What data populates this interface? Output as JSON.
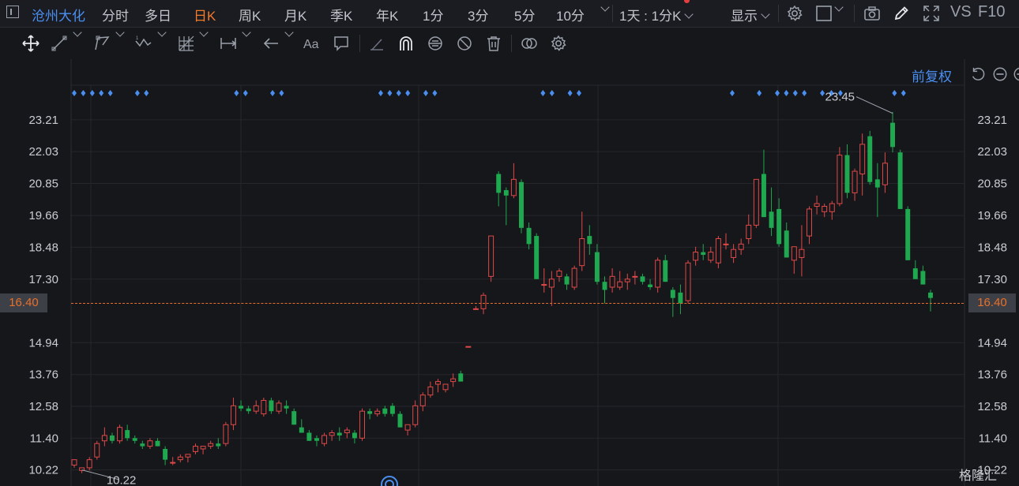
{
  "toolbar": {
    "stock_name": "沧州大化",
    "period_tabs": [
      {
        "label": "分时",
        "active": false
      },
      {
        "label": "多日",
        "active": false
      },
      {
        "label": "日K",
        "active": true
      },
      {
        "label": "周K",
        "active": false
      },
      {
        "label": "月K",
        "active": false
      },
      {
        "label": "季K",
        "active": false
      },
      {
        "label": "年K",
        "active": false
      },
      {
        "label": "1分",
        "active": false
      },
      {
        "label": "3分",
        "active": false
      },
      {
        "label": "5分",
        "active": false
      },
      {
        "label": "10分",
        "active": false
      }
    ],
    "interval_select": "1天 : 1分K",
    "display_label": "显示",
    "vs_label": "VS",
    "f10_label": "F10"
  },
  "adjust_mode": "前复权",
  "chart_data": {
    "type": "candlestick",
    "y_ticks": [
      23.21,
      22.03,
      20.85,
      19.66,
      18.48,
      17.3,
      14.94,
      13.76,
      12.58,
      11.4,
      10.22
    ],
    "ylim": [
      9.8,
      24.2
    ],
    "current_price": 16.4,
    "current_price_label": "16.40",
    "annotations": [
      {
        "label": "23.45",
        "value": 23.45,
        "type": "max"
      },
      {
        "label": "10.22",
        "value": 10.22,
        "type": "min"
      }
    ],
    "candles": [
      [
        10.4,
        10.6,
        10.3,
        10.6
      ],
      [
        10.2,
        10.3,
        10.1,
        10.3
      ],
      [
        10.3,
        10.7,
        10.2,
        10.6
      ],
      [
        10.7,
        11.3,
        10.6,
        11.2
      ],
      [
        11.3,
        11.8,
        11.1,
        11.5
      ],
      [
        11.5,
        11.6,
        11.2,
        11.3
      ],
      [
        11.3,
        11.9,
        11.2,
        11.8
      ],
      [
        11.7,
        11.9,
        11.3,
        11.4
      ],
      [
        11.4,
        11.5,
        11.2,
        11.3
      ],
      [
        11.2,
        11.3,
        11.0,
        11.1
      ],
      [
        11.1,
        11.4,
        11.0,
        11.3
      ],
      [
        11.3,
        11.4,
        11.1,
        11.1
      ],
      [
        11.0,
        11.1,
        10.4,
        10.6
      ],
      [
        10.5,
        10.7,
        10.4,
        10.5
      ],
      [
        10.6,
        10.8,
        10.5,
        10.7
      ],
      [
        10.7,
        10.8,
        10.5,
        10.8
      ],
      [
        10.9,
        11.2,
        10.8,
        11.1
      ],
      [
        11.0,
        11.1,
        10.8,
        11.1
      ],
      [
        11.1,
        11.3,
        11.0,
        11.2
      ],
      [
        11.2,
        11.4,
        11.0,
        11.1
      ],
      [
        11.2,
        12.0,
        11.1,
        11.9
      ],
      [
        11.9,
        12.9,
        11.7,
        12.6
      ],
      [
        12.6,
        12.8,
        12.4,
        12.5
      ],
      [
        12.5,
        12.6,
        12.3,
        12.4
      ],
      [
        12.4,
        12.8,
        12.3,
        12.6
      ],
      [
        12.3,
        12.9,
        12.2,
        12.8
      ],
      [
        12.8,
        12.9,
        12.3,
        12.4
      ],
      [
        12.4,
        12.8,
        12.3,
        12.7
      ],
      [
        12.6,
        12.8,
        12.3,
        12.5
      ],
      [
        12.4,
        12.5,
        11.9,
        11.9
      ],
      [
        11.8,
        12.1,
        11.6,
        11.6
      ],
      [
        11.6,
        11.7,
        11.3,
        11.3
      ],
      [
        11.4,
        11.5,
        11.1,
        11.3
      ],
      [
        11.2,
        11.6,
        11.1,
        11.5
      ],
      [
        11.5,
        11.7,
        11.3,
        11.6
      ],
      [
        11.6,
        11.8,
        11.3,
        11.5
      ],
      [
        11.6,
        11.8,
        11.4,
        11.7
      ],
      [
        11.6,
        11.7,
        11.2,
        11.4
      ],
      [
        11.4,
        12.5,
        11.3,
        12.4
      ],
      [
        12.4,
        12.5,
        12.1,
        12.3
      ],
      [
        12.3,
        12.5,
        12.2,
        12.4
      ],
      [
        12.5,
        12.6,
        12.2,
        12.3
      ],
      [
        12.6,
        12.7,
        12.2,
        12.3
      ],
      [
        12.3,
        12.4,
        11.8,
        11.8
      ],
      [
        11.7,
        11.9,
        11.5,
        11.9
      ],
      [
        11.9,
        12.8,
        11.8,
        12.6
      ],
      [
        12.6,
        13.1,
        12.4,
        13.0
      ],
      [
        13.0,
        13.5,
        12.9,
        13.3
      ],
      [
        13.4,
        13.6,
        13.1,
        13.5
      ],
      [
        13.2,
        13.4,
        13.1,
        13.4
      ],
      [
        13.5,
        13.8,
        13.3,
        13.6
      ],
      [
        13.8,
        13.9,
        13.5,
        13.5
      ],
      [
        14.8,
        14.8,
        14.8,
        14.8
      ],
      [
        16.2,
        16.3,
        16.2,
        16.2
      ],
      [
        16.2,
        16.8,
        16.0,
        16.7
      ],
      [
        17.4,
        18.9,
        17.2,
        18.9
      ],
      [
        21.2,
        21.3,
        20.0,
        20.5
      ],
      [
        20.6,
        20.7,
        19.3,
        20.4
      ],
      [
        20.4,
        21.6,
        20.3,
        21.0
      ],
      [
        20.9,
        21.0,
        19.0,
        19.2
      ],
      [
        19.2,
        19.4,
        18.4,
        18.6
      ],
      [
        18.9,
        19.0,
        17.3,
        17.3
      ],
      [
        17.1,
        17.7,
        16.8,
        17.1
      ],
      [
        17.0,
        17.6,
        16.3,
        17.3
      ],
      [
        17.4,
        17.7,
        17.2,
        17.6
      ],
      [
        17.4,
        17.5,
        16.9,
        17.1
      ],
      [
        17.0,
        17.8,
        16.9,
        17.7
      ],
      [
        17.8,
        19.8,
        17.6,
        18.8
      ],
      [
        18.9,
        19.3,
        18.2,
        18.6
      ],
      [
        18.3,
        18.6,
        17.1,
        17.2
      ],
      [
        17.2,
        17.4,
        16.4,
        16.9
      ],
      [
        17.0,
        17.7,
        16.8,
        17.4
      ],
      [
        17.0,
        17.6,
        16.9,
        17.2
      ],
      [
        17.2,
        17.5,
        16.9,
        17.3
      ],
      [
        17.4,
        17.6,
        17.1,
        17.4
      ],
      [
        17.4,
        17.5,
        17.1,
        17.2
      ],
      [
        17.1,
        17.3,
        16.9,
        17.0
      ],
      [
        17.0,
        18.1,
        16.8,
        18.0
      ],
      [
        18.0,
        18.2,
        17.2,
        17.2
      ],
      [
        16.9,
        17.0,
        15.9,
        16.6
      ],
      [
        16.8,
        17.1,
        16.0,
        16.4
      ],
      [
        16.5,
        18.0,
        16.4,
        17.9
      ],
      [
        18.0,
        18.5,
        17.8,
        18.3
      ],
      [
        18.3,
        18.6,
        18.0,
        18.2
      ],
      [
        18.0,
        18.5,
        17.9,
        18.3
      ],
      [
        17.9,
        18.9,
        17.7,
        18.8
      ],
      [
        18.6,
        19.0,
        18.4,
        18.6
      ],
      [
        18.1,
        18.6,
        17.9,
        18.4
      ],
      [
        18.4,
        18.8,
        18.2,
        18.6
      ],
      [
        18.8,
        19.7,
        18.6,
        19.3
      ],
      [
        19.3,
        21.0,
        19.2,
        21.0
      ],
      [
        21.2,
        22.1,
        19.8,
        19.6
      ],
      [
        19.8,
        20.7,
        18.9,
        19.2
      ],
      [
        19.9,
        20.3,
        18.5,
        18.6
      ],
      [
        19.1,
        19.4,
        18.3,
        18.1
      ],
      [
        18.0,
        18.2,
        17.5,
        18.5
      ],
      [
        18.1,
        19.3,
        17.4,
        18.4
      ],
      [
        18.9,
        20.0,
        18.6,
        19.9
      ],
      [
        20.0,
        20.4,
        19.7,
        20.1
      ],
      [
        19.8,
        20.1,
        19.6,
        20.0
      ],
      [
        19.8,
        20.2,
        19.5,
        20.1
      ],
      [
        20.1,
        22.2,
        20.0,
        21.9
      ],
      [
        21.9,
        22.3,
        20.3,
        20.5
      ],
      [
        20.5,
        21.4,
        20.2,
        21.3
      ],
      [
        21.2,
        22.7,
        20.4,
        22.3
      ],
      [
        22.6,
        22.8,
        20.8,
        20.9
      ],
      [
        21.0,
        21.6,
        19.6,
        20.7
      ],
      [
        20.8,
        22.0,
        20.5,
        21.6
      ],
      [
        23.1,
        23.5,
        22.0,
        22.2
      ],
      [
        22.0,
        22.1,
        19.9,
        19.9
      ],
      [
        19.9,
        20.0,
        18.0,
        18.0
      ],
      [
        17.7,
        18.0,
        17.3,
        17.3
      ],
      [
        17.6,
        17.8,
        17.1,
        17.1
      ],
      [
        16.8,
        16.9,
        16.1,
        16.6
      ]
    ],
    "signal_dots": [
      0,
      1,
      2,
      3,
      4,
      7,
      8,
      18,
      19,
      22,
      23,
      34,
      35,
      36,
      37,
      39,
      40,
      52,
      53,
      55,
      56,
      73,
      76,
      78,
      79,
      80,
      81,
      83,
      84,
      85,
      91,
      92
    ]
  },
  "watermark": "格隆汇"
}
